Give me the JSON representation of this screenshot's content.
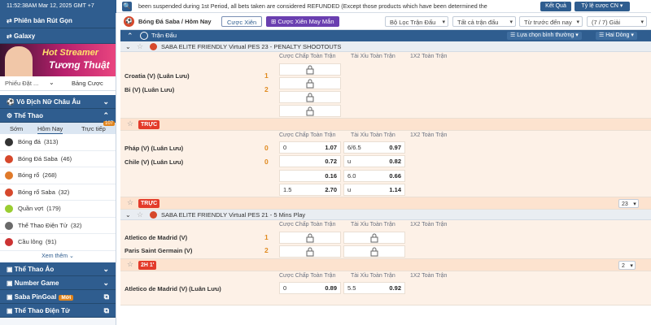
{
  "topbar": {
    "clock": "11:52:38AM Mar 12, 2025 GMT +7",
    "ticker": "been suspended during 1st Period, all bets taken are considered REFUNDED (Except those products which have been determined the",
    "ket_qua": "Kết Quả",
    "ty_le": "Tỷ lệ cược CN"
  },
  "sidebar": {
    "phien_ban": "Phiên bản Rút Gọn",
    "galaxy": "Galaxy",
    "banner_line1": "Hot Streamer",
    "banner_line2": "Tương Thuật",
    "filter_placeholder": "Phiếu Đặt ...",
    "bang_cuoc": "Bảng Cược",
    "vo_dich": "Vô Địch Nữ Châu Âu",
    "the_thao": "Thể Thao",
    "tabs": {
      "som": "Sớm",
      "hom_nay": "Hôm Nay",
      "truc_tiep": "Trực tiếp",
      "badge": "107"
    },
    "sports": [
      {
        "label": "Bóng đá",
        "count": "(313)",
        "color": "#333"
      },
      {
        "label": "Bóng Đá Saba",
        "count": "(46)",
        "color": "#d6482c"
      },
      {
        "label": "Bóng rổ",
        "count": "(268)",
        "color": "#e07a2a"
      },
      {
        "label": "Bóng rổ Saba",
        "count": "(32)",
        "color": "#d6482c"
      },
      {
        "label": "Quần vợt",
        "count": "(179)",
        "color": "#9acd32"
      },
      {
        "label": "Thể Thao Điện Tử",
        "count": "(32)",
        "color": "#6a6a6a"
      },
      {
        "label": "Cầu lông",
        "count": "(91)",
        "color": "#c33"
      }
    ],
    "xem_them": "Xem thêm",
    "the_thao_ao": "Thể Thao Ảo",
    "number_game": "Number Game",
    "saba_pingoal": "Saba PinGoal",
    "moi": "Mới",
    "the_thao_dien_tu": "Thể Thao Điện Tử"
  },
  "toolbar": {
    "breadcrumb": "Bóng Đá Saba / Hôm Nay",
    "cuoc_xien": "Cược Xiên",
    "cuoc_xien_may_man": "Cược Xiên May Mắn",
    "bo_loc": "Bộ Lọc Trận Đấu",
    "tat_ca": "Tất cả trận đấu",
    "tu_truoc": "Từ trước đến nay",
    "giai": "(7 / 7) Giải"
  },
  "header": {
    "tran_dau": "Trận Đấu",
    "lua_chon": "Lựa chọn bình thường",
    "hai_dong": "Hai Dòng"
  },
  "columns": {
    "chap": "Cược Chấp Toàn Trận",
    "taixiu": "Tài Xỉu Toàn Trận",
    "x12": "1X2 Toàn Trận"
  },
  "league1": "SABA ELITE FRIENDLY Virtual PES 23 - PENALTY SHOOTOUTS",
  "match1": {
    "home": "Croatia (V) (Luân Lưu)",
    "away": "Bỉ (V) (Luân Lưu)",
    "home_score": "1",
    "away_score": "2"
  },
  "live_label": "TRỰC",
  "match2": {
    "home": "Pháp (V) (Luân Lưu)",
    "away": "Chile (V) (Luân Lưu)",
    "home_score": "0",
    "away_score": "0",
    "r1": {
      "hdp": "0",
      "hdp_odds": "1.07",
      "ou": "6/6.5",
      "ou_odds": "0.97"
    },
    "r2": {
      "hdp_odds": "0.72",
      "ou": "u",
      "ou_odds": "0.82"
    },
    "r3": {
      "hdp_odds": "0.16",
      "ou": "6.0",
      "ou_odds": "0.66"
    },
    "r4": {
      "hdp": "1.5",
      "hdp_odds": "2.70",
      "ou": "u",
      "ou_odds": "1.14"
    }
  },
  "more_count1": "23",
  "league2": "SABA ELITE FRIENDLY Virtual PES 21 - 5 Mins Play",
  "match3": {
    "home": "Atletico de Madrid (V)",
    "away": "Paris Saint Germain (V)",
    "home_score": "1",
    "away_score": "2"
  },
  "live2_label": "2H 1'",
  "more_count2": "2",
  "match4": {
    "home": "Atletico de Madrid (V) (Luân Lưu)",
    "hdp": "0",
    "hdp_odds": "0.89",
    "ou": "5.5",
    "ou_odds": "0.92"
  }
}
